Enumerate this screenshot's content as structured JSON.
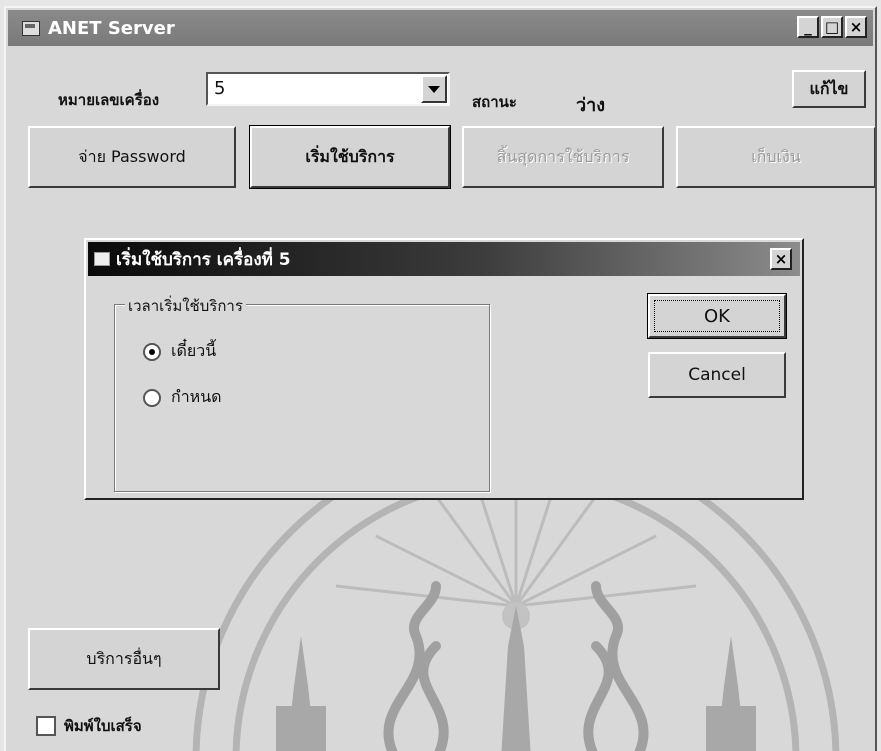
{
  "window": {
    "title": "ANET Server",
    "minimize_glyph": "_",
    "maximize_glyph": "□",
    "close_glyph": "×"
  },
  "machine": {
    "label": "หมายเลขเครื่อง",
    "value": "5"
  },
  "status": {
    "label": "สถานะ",
    "value": "ว่าง"
  },
  "buttons": {
    "edit": "แก้ไข",
    "pay_password": "จ่าย Password",
    "start_service": "เริ่มใช้บริการ",
    "end_service": "สิ้นสุดการใช้บริการ",
    "collect": "เก็บเงิน",
    "other_services": "บริการอื่นๆ"
  },
  "print_receipt": {
    "label": "พิมพ์ใบเสร็จ",
    "checked": false
  },
  "dialog": {
    "title": "เริ่มใช้บริการ เครื่องที่ 5",
    "close_glyph": "×",
    "group_label": "เวลาเริ่มใช้บริการ",
    "options": [
      {
        "label": "เดี๋ยวนี้",
        "checked": true
      },
      {
        "label": "กำหนด",
        "checked": false
      }
    ],
    "ok": "OK",
    "cancel": "Cancel"
  },
  "colors": {
    "face": "#d8d8d8",
    "title_inactive": "#7a7a7a",
    "dialog_title": "#0a0a0a",
    "watermark": "#b8b8b8"
  }
}
